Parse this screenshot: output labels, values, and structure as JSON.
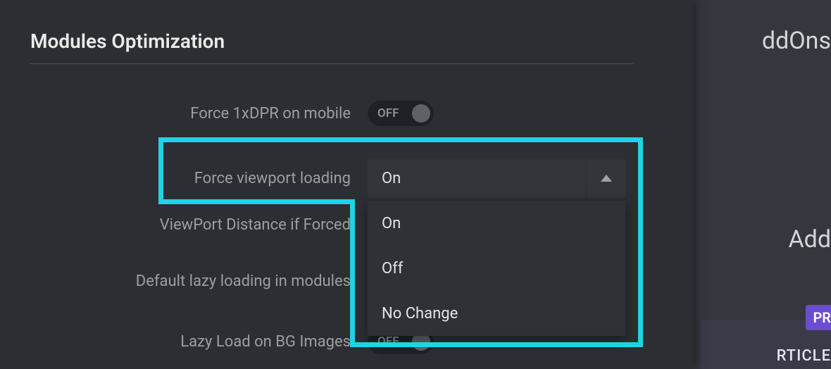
{
  "section": {
    "title": "Modules Optimization"
  },
  "rows": {
    "force_dpr": {
      "label": "Force 1xDPR on mobile",
      "toggle": "OFF"
    },
    "force_viewport": {
      "label": "Force viewport loading",
      "value": "On",
      "options": [
        "On",
        "Off",
        "No Change"
      ]
    },
    "viewport_distance": {
      "label": "ViewPort Distance if Forced"
    },
    "default_lazy": {
      "label": "Default lazy loading in modules"
    },
    "lazy_bg": {
      "label": "Lazy Load on BG Images",
      "toggle": "OFF"
    }
  },
  "background": {
    "text1": "ddOns",
    "text2": "Add",
    "badge": "PR",
    "card_text": "RTICLE"
  }
}
